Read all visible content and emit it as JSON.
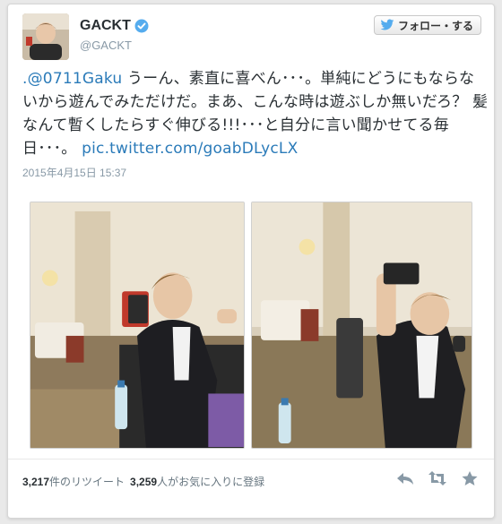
{
  "user": {
    "display_name": "GACKT",
    "screen_name": "@GACKT",
    "verified": true
  },
  "follow_button": {
    "label": "フォロー・する",
    "icon": "twitter-bird-icon"
  },
  "tweet": {
    "mention": ".@0711Gaku",
    "body": " うーん、素直に喜べん･･･。単純にどうにもならないから遊んでみただけだ。まあ、こんな時は遊ぶしか無いだろ？ 髪なんて暫くしたらすぐ伸びる!!!･･･と自分に言い聞かせてる毎日･･･。",
    "link": "pic.twitter.com/goabDLycLX",
    "timestamp": "2015年4月15日 15:37"
  },
  "media": {
    "photos": [
      {
        "name": "selfie-photo-left"
      },
      {
        "name": "selfie-photo-right"
      }
    ]
  },
  "stats": {
    "retweets_count": "3,217",
    "retweets_label": "件のリツイート",
    "favorites_count": "3,259",
    "favorites_label": "人がお気に入りに登録"
  },
  "actions": [
    "reply-icon",
    "retweet-icon",
    "favorite-icon"
  ],
  "colors": {
    "link": "#2b7bb9",
    "verified": "#55acee",
    "muted": "#8899a6"
  }
}
